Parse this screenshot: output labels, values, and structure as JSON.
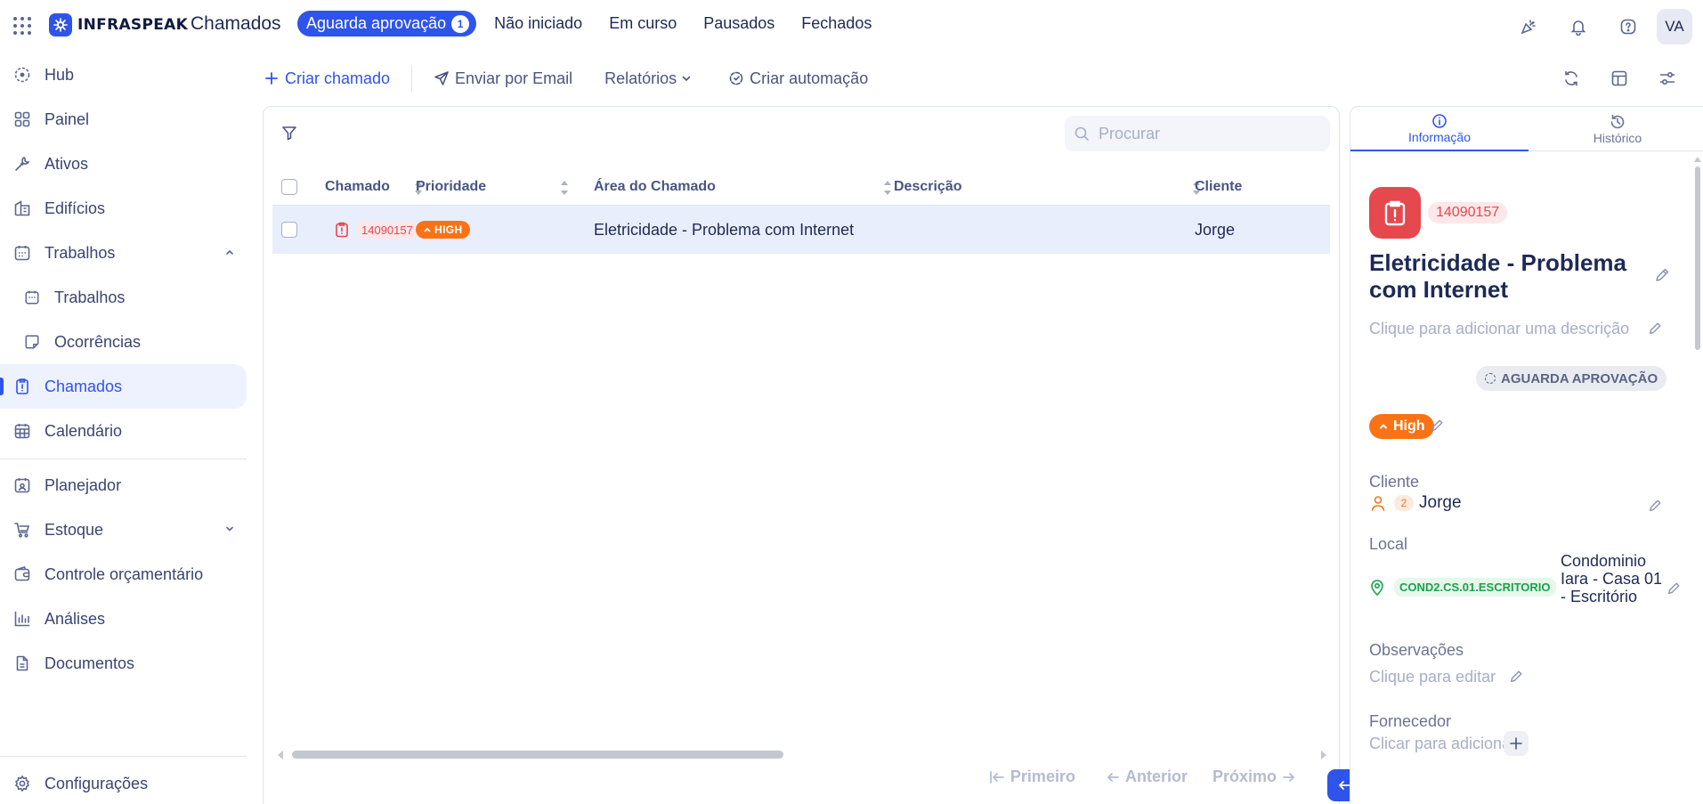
{
  "app": {
    "brand": "INFRASPEAK",
    "page_title": "Chamados",
    "avatar_initials": "VA",
    "accent": "#2f54eb"
  },
  "status_tabs": [
    {
      "label": "Aguarda aprovação",
      "count": "1",
      "active": true
    },
    {
      "label": "Não iniciado"
    },
    {
      "label": "Em curso"
    },
    {
      "label": "Pausados"
    },
    {
      "label": "Fechados"
    }
  ],
  "sidebar": {
    "items": [
      {
        "label": "Hub",
        "icon": "hub-icon"
      },
      {
        "label": "Painel",
        "icon": "dashboard-icon"
      },
      {
        "label": "Ativos",
        "icon": "wrench-icon"
      },
      {
        "label": "Edifícios",
        "icon": "building-icon"
      },
      {
        "label": "Trabalhos",
        "icon": "calendar-icon"
      },
      {
        "label": "Trabalhos",
        "icon": "calendar-icon"
      },
      {
        "label": "Ocorrências",
        "icon": "sticky-note-icon"
      },
      {
        "label": "Chamados",
        "icon": "clipboard-icon"
      },
      {
        "label": "Calendário",
        "icon": "calendar-grid-icon"
      },
      {
        "label": "Planejador",
        "icon": "planner-icon"
      },
      {
        "label": "Estoque",
        "icon": "cart-icon"
      },
      {
        "label": "Controle orçamentário",
        "icon": "wallet-icon"
      },
      {
        "label": "Análises",
        "icon": "bar-chart-icon"
      },
      {
        "label": "Documentos",
        "icon": "document-icon"
      },
      {
        "label": "Configurações",
        "icon": "gear-icon"
      }
    ]
  },
  "toolbar": {
    "create": "Criar chamado",
    "email": "Enviar por Email",
    "reports": "Relatórios",
    "automation": "Criar automação"
  },
  "search": {
    "placeholder": "Procurar"
  },
  "table": {
    "columns": [
      "Chamado",
      "Prioridade",
      "Área do Chamado",
      "Descrição",
      "Cliente"
    ],
    "rows": [
      {
        "id": "14090157",
        "priority": "HIGH",
        "area": "Eletricidade - Problema com Internet",
        "description": "",
        "client": "Jorge"
      }
    ]
  },
  "pager": {
    "first": "Primeiro",
    "prev": "Anterior",
    "next": "Próximo"
  },
  "detail": {
    "tabs": [
      "Informação",
      "Histórico"
    ],
    "id": "14090157",
    "title": "Eletricidade - Problema com Internet",
    "description_placeholder": "Clique para adicionar uma descrição",
    "status": "AGUARDA APROVAÇÃO",
    "priority": "High",
    "client_label": "Cliente",
    "client_count": "2",
    "client_name": "Jorge",
    "local_label": "Local",
    "local_code": "COND2.CS.01.ESCRITORIO",
    "local_name": "Condominio Iara - Casa 01 - Escritório",
    "obs_label": "Observações",
    "obs_placeholder": "Clique para editar",
    "supplier_label": "Fornecedor",
    "supplier_placeholder": "Clicar para adicionar"
  }
}
